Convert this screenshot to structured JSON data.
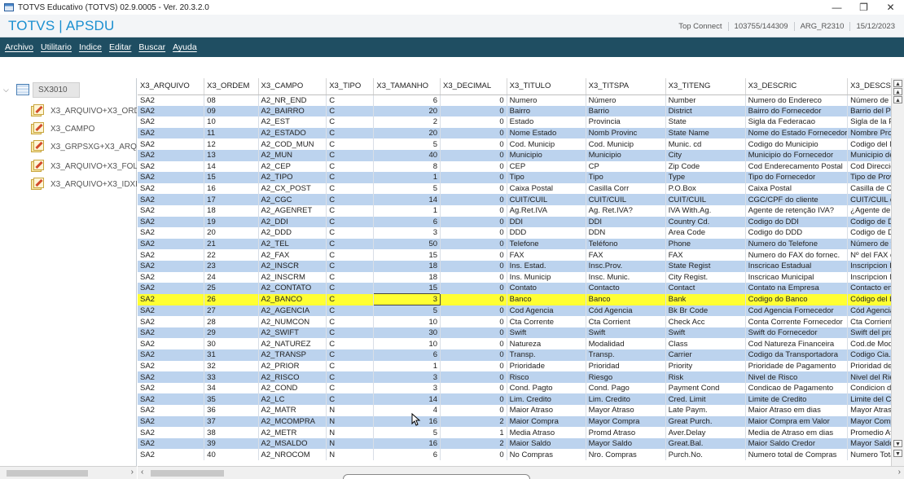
{
  "window": {
    "title": "TOTVS Educativo (TOTVS) 02.9.0005 - Ver. 20.3.2.0",
    "minimize": "—",
    "maximize": "❐",
    "close": "✕"
  },
  "header": {
    "brand": "TOTVS | APSDU",
    "connection": "Top Connect",
    "session": "103755/144309",
    "release": "ARG_R2310",
    "date": "15/12/2023"
  },
  "menu": [
    "Archivo",
    "Utilitario",
    "Indice",
    "Editar",
    "Buscar",
    "Ayuda"
  ],
  "tree": {
    "root": "SX3010",
    "indexes": [
      "X3_ARQUIVO+X3_ORDEM",
      "X3_CAMPO",
      "X3_GRPSXG+X3_ARQUIVO",
      "X3_ARQUIVO+X3_FOLDER",
      "X3_ARQUIVO+X3_IDXFLD"
    ]
  },
  "grid": {
    "columns": [
      "X3_ARQUIVO",
      "X3_ORDEM",
      "X3_CAMPO",
      "X3_TIPO",
      "X3_TAMANHO",
      "X3_DECIMAL",
      "X3_TITULO",
      "X3_TITSPA",
      "X3_TITENG",
      "X3_DESCRIC",
      "X3_DESCSPA"
    ],
    "selected_row": 18,
    "rows": [
      [
        "SA2",
        "08",
        "A2_NR_END",
        "C",
        "6",
        "0",
        "Numero",
        "Número",
        "Number",
        "Numero do Endereco",
        "Número de la direc"
      ],
      [
        "SA2",
        "09",
        "A2_BAIRRO",
        "C",
        "20",
        "0",
        "Bairro",
        "Barrio",
        "District",
        "Bairro do Fornecedor",
        "Barrio del Proveed"
      ],
      [
        "SA2",
        "10",
        "A2_EST",
        "C",
        "2",
        "0",
        "Estado",
        "Provincia",
        "State",
        "Sigla da Federacao",
        "Sigla de la Provincia"
      ],
      [
        "SA2",
        "11",
        "A2_ESTADO",
        "C",
        "20",
        "0",
        "Nome Estado",
        "Nomb Provinc",
        "State Name",
        "Nome do Estado Fornecedor",
        "Nombre Prov. Prov"
      ],
      [
        "SA2",
        "12",
        "A2_COD_MUN",
        "C",
        "5",
        "0",
        "Cod. Municip",
        "Cod. Municip",
        "Munic. cd",
        "Codigo do Municipio",
        "Codigo del Municip"
      ],
      [
        "SA2",
        "13",
        "A2_MUN",
        "C",
        "40",
        "0",
        "Municipio",
        "Municipio",
        "City",
        "Municipio do Fornecedor",
        "Municipio del Prov"
      ],
      [
        "SA2",
        "14",
        "A2_CEP",
        "C",
        "8",
        "0",
        "CEP",
        "CP",
        "Zip Code",
        "Cod Enderecamento Postal",
        "Cod Direccion Post"
      ],
      [
        "SA2",
        "15",
        "A2_TIPO",
        "C",
        "1",
        "0",
        "Tipo",
        "Tipo",
        "Type",
        "Tipo do Fornecedor",
        "Tipo de Proveedor"
      ],
      [
        "SA2",
        "16",
        "A2_CX_POST",
        "C",
        "5",
        "0",
        "Caixa Postal",
        "Casilla Corr",
        "P.O.Box",
        "Caixa Postal",
        "Casilla de Correo"
      ],
      [
        "SA2",
        "17",
        "A2_CGC",
        "C",
        "14",
        "0",
        "CUIT/CUIL",
        "CUIT/CUIL",
        "CUIT/CUIL",
        "CGC/CPF do cliente",
        "CUIT/CUIL del Clie"
      ],
      [
        "SA2",
        "18",
        "A2_AGENRET",
        "C",
        "1",
        "0",
        "Ag.Ret.IVA",
        "Ag. Ret.IVA?",
        "IVA With.Ag.",
        "Agente de retenção IVA?",
        "¿Agente de retenc"
      ],
      [
        "SA2",
        "19",
        "A2_DDI",
        "C",
        "6",
        "0",
        "DDI",
        "DDI",
        "Country Cd.",
        "Codigo do DDI",
        "Codigo de DDI"
      ],
      [
        "SA2",
        "20",
        "A2_DDD",
        "C",
        "3",
        "0",
        "DDD",
        "DDN",
        "Area Code",
        "Codigo do DDD",
        "Codigo de DDN"
      ],
      [
        "SA2",
        "21",
        "A2_TEL",
        "C",
        "50",
        "0",
        "Telefone",
        "Teléfono",
        "Phone",
        "Numero do Telefone",
        "Número de teléfon"
      ],
      [
        "SA2",
        "22",
        "A2_FAX",
        "C",
        "15",
        "0",
        "FAX",
        "FAX",
        "FAX",
        "Numero do FAX do fornec.",
        "Nº del FAX del pro"
      ],
      [
        "SA2",
        "23",
        "A2_INSCR",
        "C",
        "18",
        "0",
        "Ins. Estad.",
        "Insc.Prov.",
        "State Regist",
        "Inscricao Estadual",
        "Inscripcion Provinc"
      ],
      [
        "SA2",
        "24",
        "A2_INSCRM",
        "C",
        "18",
        "0",
        "Ins. Municip",
        "Insc. Munic.",
        "City Regist.",
        "Inscricao Municipal",
        "Inscripcion Munici"
      ],
      [
        "SA2",
        "25",
        "A2_CONTATO",
        "C",
        "15",
        "0",
        "Contato",
        "Contacto",
        "Contact",
        "Contato na Empresa",
        "Contacto en la Em"
      ],
      [
        "SA2",
        "26",
        "A2_BANCO",
        "C",
        "3",
        "0",
        "Banco",
        "Banco",
        "Bank",
        "Codigo do Banco",
        "Código del banco"
      ],
      [
        "SA2",
        "27",
        "A2_AGENCIA",
        "C",
        "5",
        "0",
        "Cod Agencia",
        "Cód Agencia",
        "Bk Br Code",
        "Cod Agencia Fornecedor",
        "Cód Agencia Prove"
      ],
      [
        "SA2",
        "28",
        "A2_NUMCON",
        "C",
        "10",
        "0",
        "Cta Corrente",
        "Cta Corrient",
        "Check Acc",
        "Conta Corrente Fornecedor",
        "Cta Corriente prov"
      ],
      [
        "SA2",
        "29",
        "A2_SWIFT",
        "C",
        "30",
        "0",
        "Swift",
        "Swift",
        "Swift",
        "Swift do Fornecedor",
        "Swift del proveedor"
      ],
      [
        "SA2",
        "30",
        "A2_NATUREZ",
        "C",
        "10",
        "0",
        "Natureza",
        "Modalidad",
        "Class",
        "Cod Natureza Financeira",
        "Cod.de Modalidad"
      ],
      [
        "SA2",
        "31",
        "A2_TRANSP",
        "C",
        "6",
        "0",
        "Transp.",
        "Transp.",
        "Carrier",
        "Codigo da Transportadora",
        "Codigo Cia. Transp"
      ],
      [
        "SA2",
        "32",
        "A2_PRIOR",
        "C",
        "1",
        "0",
        "Prioridade",
        "Prioridad",
        "Priority",
        "Prioridade de Pagamento",
        "Prioridad de Pago"
      ],
      [
        "SA2",
        "33",
        "A2_RISCO",
        "C",
        "3",
        "0",
        "Risco",
        "Riesgo",
        "Risk",
        "Nivel de Risco",
        "Nivel del Riesgo"
      ],
      [
        "SA2",
        "34",
        "A2_COND",
        "C",
        "3",
        "0",
        "Cond. Pagto",
        "Cond. Pago",
        "Payment Cond",
        "Condicao de Pagamento",
        "Condicion de Pago"
      ],
      [
        "SA2",
        "35",
        "A2_LC",
        "C",
        "14",
        "0",
        "Lim. Credito",
        "Lim. Credito",
        "Cred. Limit",
        "Limite de Credito",
        "Limite del Credito"
      ],
      [
        "SA2",
        "36",
        "A2_MATR",
        "N",
        "4",
        "0",
        "Maior Atraso",
        "Mayor Atraso",
        "Late Paym.",
        "Maior Atraso em dias",
        "Mayor Atraso en di"
      ],
      [
        "SA2",
        "37",
        "A2_MCOMPRA",
        "N",
        "16",
        "2",
        "Maior Compra",
        "Mayor Compra",
        "Great Purch.",
        "Maior Compra em Valor",
        "Mayor Compra en V"
      ],
      [
        "SA2",
        "38",
        "A2_METR",
        "N",
        "5",
        "1",
        "Media Atraso",
        "Promd Atraso",
        "Aver.Delay",
        "Media de Atraso em dias",
        "Promedio Atraso en"
      ],
      [
        "SA2",
        "39",
        "A2_MSALDO",
        "N",
        "16",
        "2",
        "Maior Saldo",
        "Mayor Saldo",
        "Great.Bal.",
        "Maior Saldo Credor",
        "Mayor Saldo"
      ],
      [
        "SA2",
        "40",
        "A2_NROCOM",
        "N",
        "6",
        "0",
        "No Compras",
        "Nro. Compras",
        "Purch.No.",
        "Numero total de Compras",
        "Numero Total de C"
      ]
    ]
  },
  "colors": {
    "brand": "#1a8fd0",
    "menubar": "#1f4e62",
    "row_alt": "#bcd3ee",
    "row_selected": "#ffff33"
  },
  "icons": {
    "root": "table-icon",
    "index": "index-edit-icon"
  }
}
